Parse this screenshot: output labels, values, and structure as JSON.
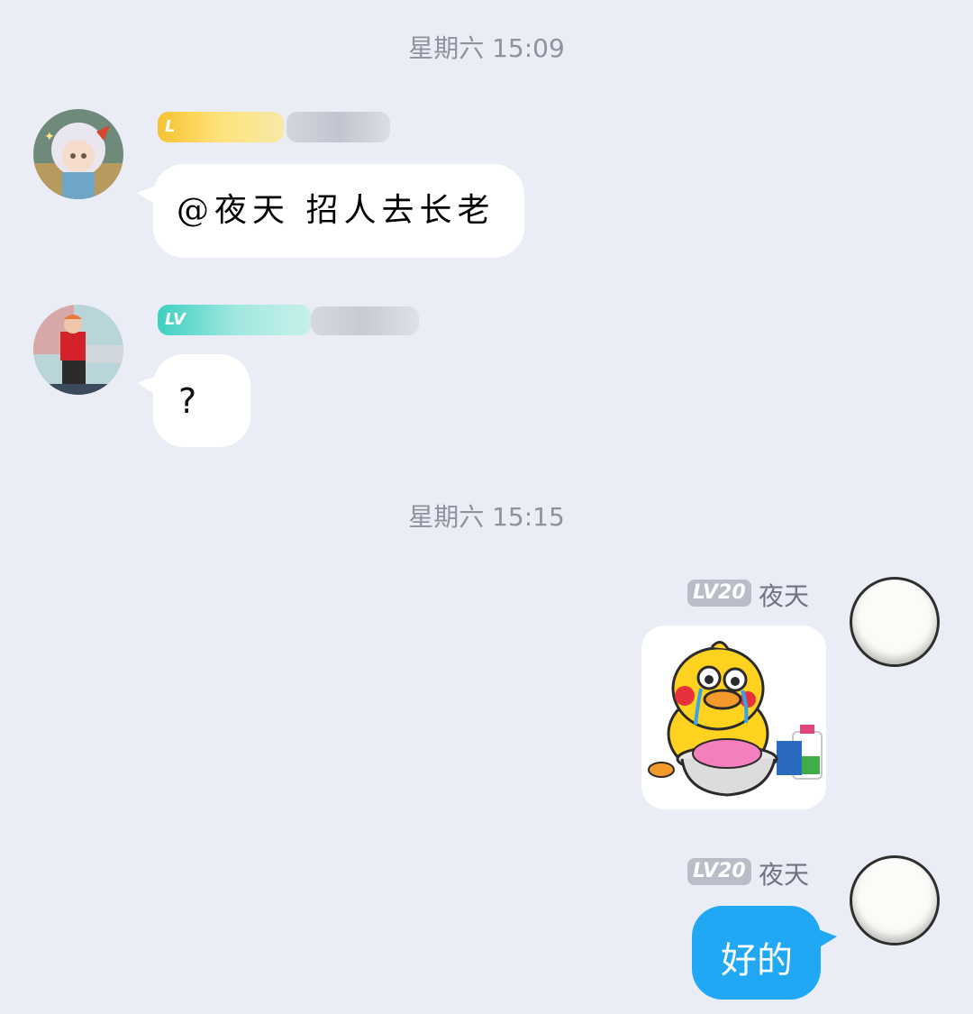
{
  "timestamps": [
    "星期六 15:09",
    "星期六 15:15"
  ],
  "messages": [
    {
      "sender_badge": "L",
      "text": "@夜天 招人去长老"
    },
    {
      "sender_badge": "LV",
      "text": "?"
    },
    {
      "sender_level": "LV20",
      "sender_name": "夜天",
      "type": "sticker",
      "sticker": "crying-duck-washing-clothes"
    },
    {
      "sender_level": "LV20",
      "sender_name": "夜天",
      "text": "好的"
    }
  ],
  "colors": {
    "background": "#eaedf5",
    "own_bubble": "#21a8f5",
    "other_bubble": "#ffffff"
  }
}
